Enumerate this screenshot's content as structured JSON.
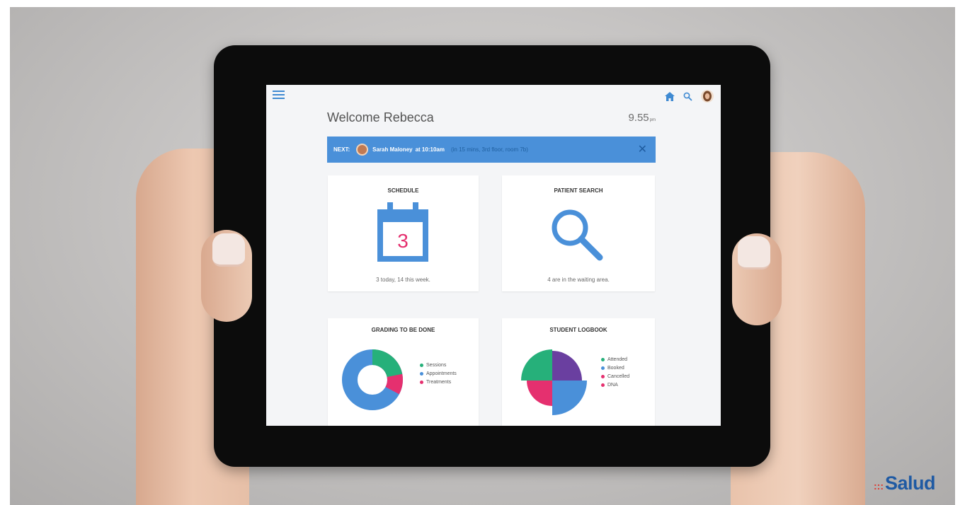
{
  "colors": {
    "primary": "#4a90d9",
    "pink": "#e5306f",
    "green": "#26b07a",
    "purple": "#6a3fa0"
  },
  "header": {
    "icons": [
      "menu-icon",
      "home-icon",
      "search-icon",
      "avatar"
    ],
    "welcome": "Welcome Rebecca",
    "time": "9.55",
    "time_suffix": "pm"
  },
  "banner": {
    "label": "NEXT:",
    "patient": "Sarah Maloney",
    "time": "at 10:10am",
    "detail": "(in 15 mins, 3rd floor, room 7b)",
    "close": "✕"
  },
  "cards": {
    "schedule": {
      "title": "SCHEDULE",
      "calendar_day": "3",
      "summary": "3 today, 14 this week."
    },
    "patient_search": {
      "title": "PATIENT SEARCH",
      "summary": "4 are in the waiting area."
    },
    "grading": {
      "title": "GRADING TO BE DONE",
      "legend": [
        "Sessions",
        "Appointments",
        "Treatments"
      ]
    },
    "logbook": {
      "title": "STUDENT LOGBOOK",
      "legend": [
        "Attended",
        "Booked",
        "Cancelled",
        "DNA"
      ]
    }
  },
  "brand": {
    "dots": ":::",
    "name": "Salud"
  }
}
